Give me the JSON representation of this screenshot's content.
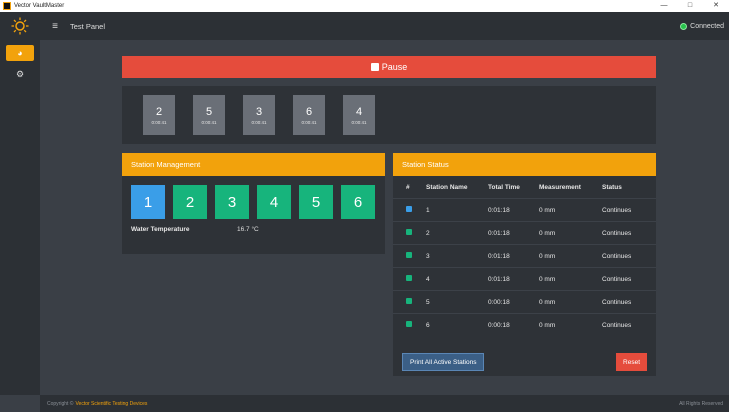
{
  "window": {
    "title": "Vector VaultMaster",
    "minimize": "—",
    "maximize": "□",
    "close": "✕"
  },
  "header": {
    "menu_icon": "≡",
    "title": "Test Panel",
    "status": "Connected",
    "status_color": "#27c24c"
  },
  "sidebar": {
    "items": [
      {
        "icon": "dashboard-icon",
        "glyph": "◕"
      },
      {
        "icon": "gears-icon",
        "glyph": "⚙"
      }
    ]
  },
  "pause": {
    "label": "Pause"
  },
  "timers": [
    {
      "num": "2",
      "time": "0:00:41"
    },
    {
      "num": "5",
      "time": "0:00:41"
    },
    {
      "num": "3",
      "time": "0:00:41"
    },
    {
      "num": "6",
      "time": "0:00:41"
    },
    {
      "num": "4",
      "time": "0:00:41"
    }
  ],
  "management": {
    "title": "Station Management",
    "stations": [
      "1",
      "2",
      "3",
      "4",
      "5",
      "6"
    ],
    "water_label": "Water Temperature",
    "water_value": "16.7 °C"
  },
  "status_table": {
    "title": "Station Status",
    "headers": [
      "#",
      "Station Name",
      "Total Time",
      "Measurement",
      "Status"
    ],
    "rows": [
      {
        "indicator": "#3a9ee8",
        "name": "1",
        "time": "0:01:18",
        "meas": "0 mm",
        "status": "Continues"
      },
      {
        "indicator": "#17b47c",
        "name": "2",
        "time": "0:01:18",
        "meas": "0 mm",
        "status": "Continues"
      },
      {
        "indicator": "#17b47c",
        "name": "3",
        "time": "0:01:18",
        "meas": "0 mm",
        "status": "Continues"
      },
      {
        "indicator": "#17b47c",
        "name": "4",
        "time": "0:01:18",
        "meas": "0 mm",
        "status": "Continues"
      },
      {
        "indicator": "#17b47c",
        "name": "5",
        "time": "0:00:18",
        "meas": "0 mm",
        "status": "Continues"
      },
      {
        "indicator": "#17b47c",
        "name": "6",
        "time": "0:00:18",
        "meas": "0 mm",
        "status": "Continues"
      }
    ],
    "print_label": "Print All Active Stations",
    "reset_label": "Reset"
  },
  "footer": {
    "copyright": "Copyright ©",
    "brand": "Vector Scientific Testing Devices",
    "rights": "All Rights Reserved"
  },
  "colors": {
    "accent": "#f2a20c",
    "danger": "#e54c3c",
    "station_active": "#3a9ee8",
    "station": "#17b47c"
  }
}
